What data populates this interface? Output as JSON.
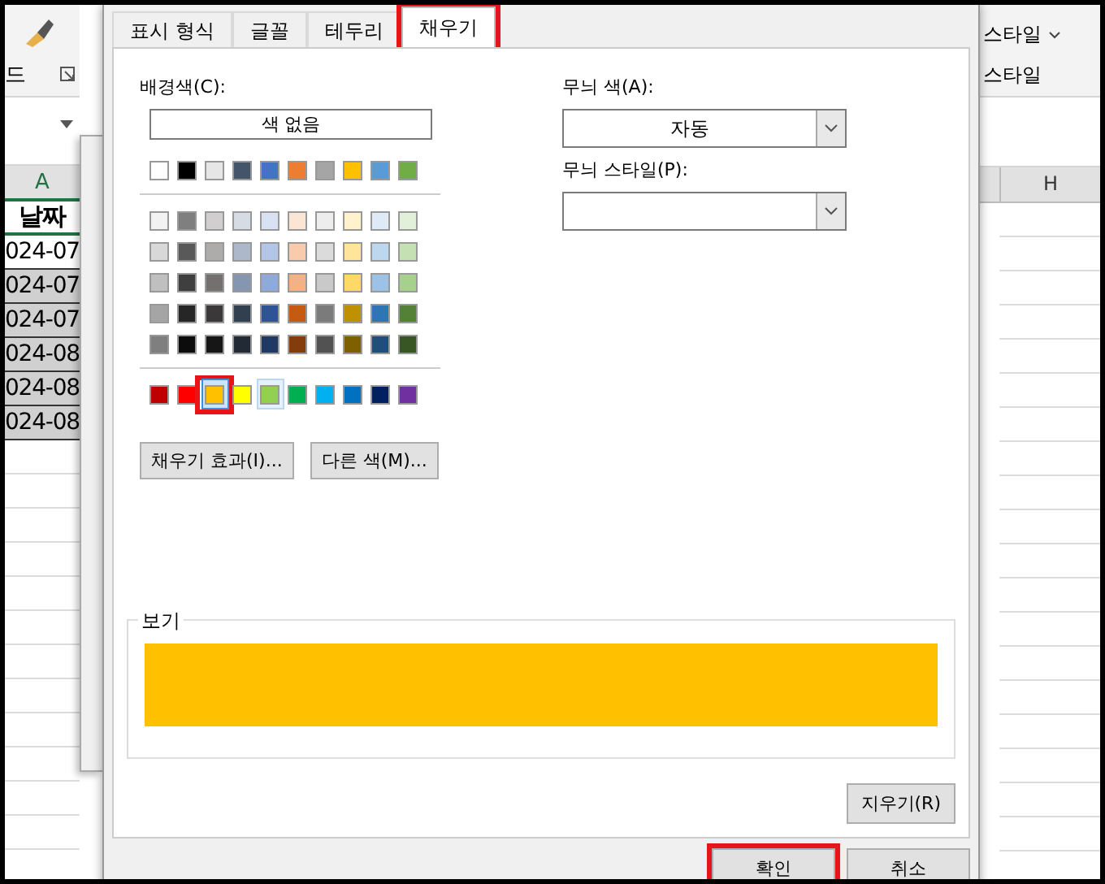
{
  "spreadsheet": {
    "left": {
      "ribbon_label": "드",
      "column_header": "A",
      "header_cell": "날짜",
      "cells": [
        {
          "text": "024-07",
          "selected": false
        },
        {
          "text": "024-07",
          "selected": true
        },
        {
          "text": "024-07",
          "selected": true
        },
        {
          "text": "024-08",
          "selected": true
        },
        {
          "text": "024-08",
          "selected": true
        },
        {
          "text": "024-08",
          "selected": true
        }
      ]
    },
    "right": {
      "ribbon_items": [
        {
          "label": "스타일",
          "dropdown": true
        },
        {
          "label": "스타일",
          "dropdown": false
        }
      ],
      "column_header": "H"
    }
  },
  "dialog": {
    "tabs": [
      {
        "label": "표시 형식",
        "selected": false,
        "annotated": false
      },
      {
        "label": "글꼴",
        "selected": false,
        "annotated": false
      },
      {
        "label": "테두리",
        "selected": false,
        "annotated": false
      },
      {
        "label": "채우기",
        "selected": true,
        "annotated": true
      }
    ],
    "background_label": "배경색(C):",
    "no_color_button": "색 없음",
    "theme_colors": [
      {
        "color": "#ffffff"
      },
      {
        "color": "#000000"
      },
      {
        "color": "#e7e6e6"
      },
      {
        "color": "#44546a"
      },
      {
        "color": "#4472c4"
      },
      {
        "color": "#ed7d31"
      },
      {
        "color": "#a5a5a5"
      },
      {
        "color": "#ffc000"
      },
      {
        "color": "#5b9bd5"
      },
      {
        "color": "#70ad47"
      }
    ],
    "tint_rows": [
      [
        {
          "color": "#f2f2f2"
        },
        {
          "color": "#7f7f7f"
        },
        {
          "color": "#d0cece"
        },
        {
          "color": "#d6dce4"
        },
        {
          "color": "#d9e2f3"
        },
        {
          "color": "#fbe5d5"
        },
        {
          "color": "#ededed"
        },
        {
          "color": "#fff2cc"
        },
        {
          "color": "#deebf6"
        },
        {
          "color": "#e2efd9"
        }
      ],
      [
        {
          "color": "#d8d8d8"
        },
        {
          "color": "#595959"
        },
        {
          "color": "#aeabab"
        },
        {
          "color": "#adb9ca"
        },
        {
          "color": "#b4c6e7"
        },
        {
          "color": "#f7cbac"
        },
        {
          "color": "#dbdbdb"
        },
        {
          "color": "#fee599"
        },
        {
          "color": "#bdd7ee"
        },
        {
          "color": "#c5e0b3"
        }
      ],
      [
        {
          "color": "#bfbfbf"
        },
        {
          "color": "#3f3f3f"
        },
        {
          "color": "#757070"
        },
        {
          "color": "#8496b0"
        },
        {
          "color": "#8eaadb"
        },
        {
          "color": "#f4b183"
        },
        {
          "color": "#c9c9c9"
        },
        {
          "color": "#ffd965"
        },
        {
          "color": "#9cc3e5"
        },
        {
          "color": "#a8d08d"
        }
      ],
      [
        {
          "color": "#a5a5a5"
        },
        {
          "color": "#262626"
        },
        {
          "color": "#3a3838"
        },
        {
          "color": "#323f4f"
        },
        {
          "color": "#2f5496"
        },
        {
          "color": "#c55a11"
        },
        {
          "color": "#7b7b7b"
        },
        {
          "color": "#bf9000"
        },
        {
          "color": "#2e75b5"
        },
        {
          "color": "#538135"
        }
      ],
      [
        {
          "color": "#7f7f7f"
        },
        {
          "color": "#0c0c0c"
        },
        {
          "color": "#171616"
        },
        {
          "color": "#222a35"
        },
        {
          "color": "#1f3864"
        },
        {
          "color": "#833c0b"
        },
        {
          "color": "#525252"
        },
        {
          "color": "#7f6000"
        },
        {
          "color": "#1e4e79"
        },
        {
          "color": "#375623"
        }
      ]
    ],
    "standard_colors": [
      {
        "color": "#c00000",
        "selected": false,
        "hovered": false,
        "annotated": false
      },
      {
        "color": "#ff0000",
        "selected": false,
        "hovered": false,
        "annotated": false
      },
      {
        "color": "#ffc000",
        "selected": true,
        "hovered": false,
        "annotated": true
      },
      {
        "color": "#ffff00",
        "selected": false,
        "hovered": false,
        "annotated": false
      },
      {
        "color": "#92d050",
        "selected": false,
        "hovered": true,
        "annotated": false
      },
      {
        "color": "#00b050",
        "selected": false,
        "hovered": false,
        "annotated": false
      },
      {
        "color": "#00b0f0",
        "selected": false,
        "hovered": false,
        "annotated": false
      },
      {
        "color": "#0070c0",
        "selected": false,
        "hovered": false,
        "annotated": false
      },
      {
        "color": "#002060",
        "selected": false,
        "hovered": false,
        "annotated": false
      },
      {
        "color": "#7030a0",
        "selected": false,
        "hovered": false,
        "annotated": false
      }
    ],
    "buttons": [
      "채우기 효과(I)...",
      "다른 색(M)..."
    ],
    "pattern_color": {
      "label": "무늬 색(A):",
      "value": "자동"
    },
    "pattern_style": {
      "label": "무늬 스타일(P):"
    },
    "preview": {
      "label": "보기",
      "color": "#ffc000"
    },
    "clear_button": "지우기(R)",
    "footer_buttons": [
      {
        "label": "확인",
        "annotated": true
      },
      {
        "label": "취소",
        "annotated": false
      }
    ]
  }
}
